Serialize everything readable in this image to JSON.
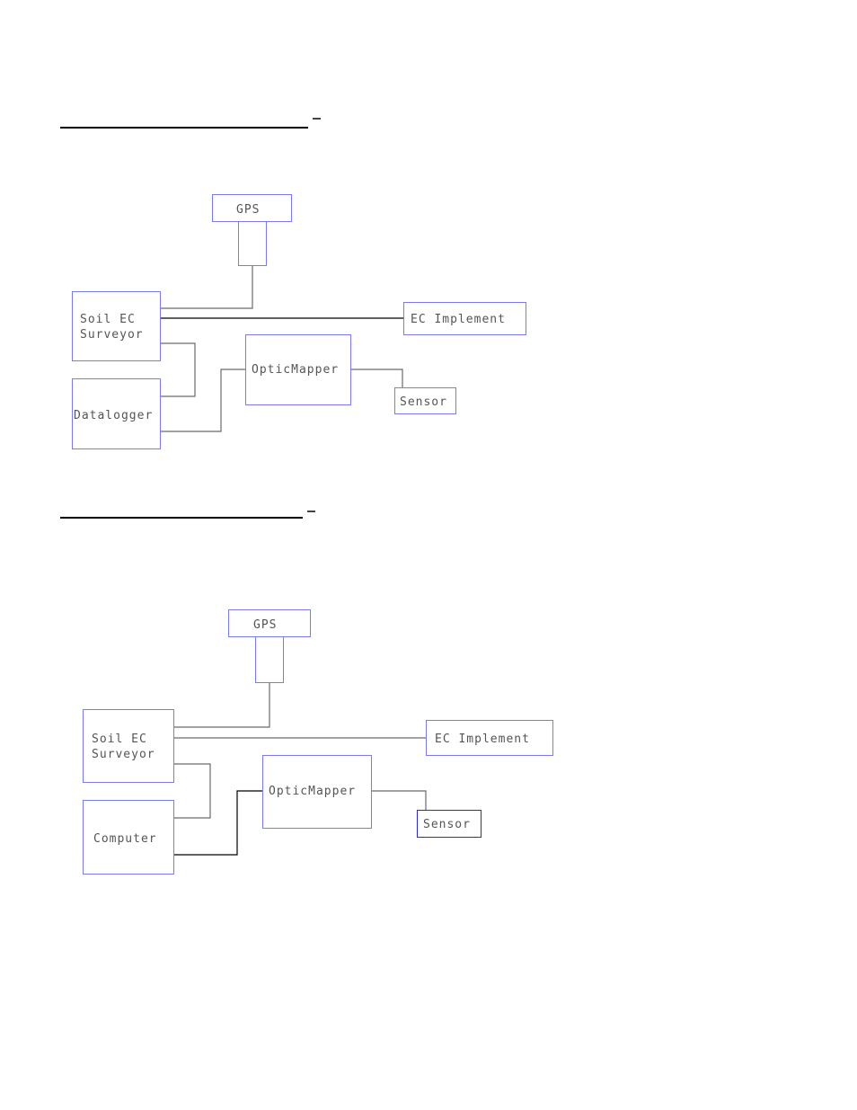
{
  "headings": [
    {
      "text": "",
      "dash": "–"
    },
    {
      "text": "",
      "dash": "–"
    }
  ],
  "diagrams": [
    {
      "id": "diagram-1",
      "nodes": {
        "gps": {
          "label": "GPS"
        },
        "soil_ec_surveyor": {
          "label_line1": "Soil EC",
          "label_line2": "Surveyor"
        },
        "logger": {
          "label": "Datalogger"
        },
        "opticmapper": {
          "label": "OpticMapper"
        },
        "ec_implement": {
          "label": "EC Implement"
        },
        "sensor": {
          "label": "Sensor"
        }
      },
      "connections": [
        [
          "gps",
          "soil_ec_surveyor"
        ],
        [
          "soil_ec_surveyor",
          "ec_implement"
        ],
        [
          "soil_ec_surveyor",
          "logger"
        ],
        [
          "logger",
          "opticmapper"
        ],
        [
          "opticmapper",
          "sensor"
        ]
      ]
    },
    {
      "id": "diagram-2",
      "nodes": {
        "gps": {
          "label": "GPS"
        },
        "soil_ec_surveyor": {
          "label_line1": "Soil EC",
          "label_line2": "Surveyor"
        },
        "logger": {
          "label": "Computer"
        },
        "opticmapper": {
          "label": "OpticMapper"
        },
        "ec_implement": {
          "label": "EC Implement"
        },
        "sensor": {
          "label": "Sensor"
        }
      },
      "connections": [
        [
          "gps",
          "soil_ec_surveyor"
        ],
        [
          "soil_ec_surveyor",
          "ec_implement"
        ],
        [
          "soil_ec_surveyor",
          "logger"
        ],
        [
          "logger",
          "opticmapper"
        ],
        [
          "opticmapper",
          "sensor"
        ]
      ]
    }
  ],
  "colors": {
    "box_stroke": "#7b7bea",
    "wire": "#6a6a6a",
    "text": "#555555"
  }
}
